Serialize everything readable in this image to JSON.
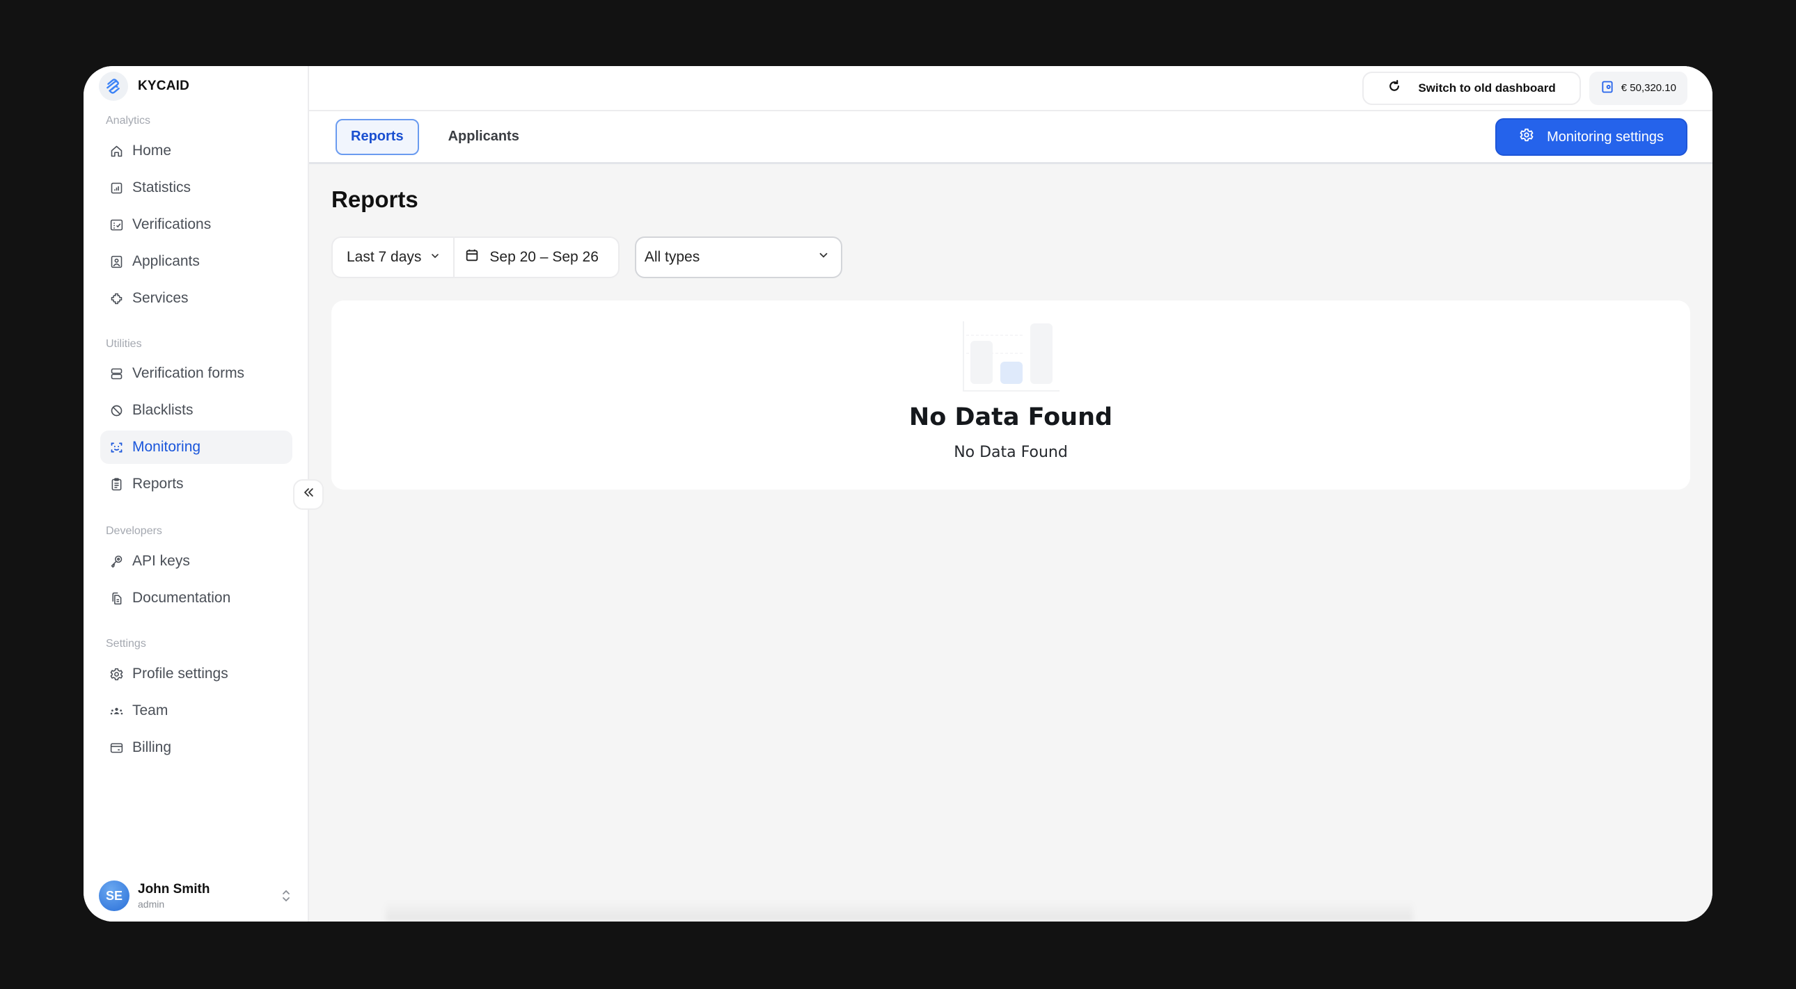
{
  "brand": {
    "name": "KYCAID",
    "icon": "kycaid-logo-icon"
  },
  "sidebar": {
    "sections": [
      {
        "label": "Analytics",
        "items": [
          {
            "label": "Home",
            "icon": "home-icon"
          },
          {
            "label": "Statistics",
            "icon": "statistics-icon"
          },
          {
            "label": "Verifications",
            "icon": "verifications-icon"
          },
          {
            "label": "Applicants",
            "icon": "applicants-icon"
          },
          {
            "label": "Services",
            "icon": "services-icon"
          }
        ]
      },
      {
        "label": "Utilities",
        "items": [
          {
            "label": "Verification forms",
            "icon": "forms-icon"
          },
          {
            "label": "Blacklists",
            "icon": "blacklist-icon"
          },
          {
            "label": "Monitoring",
            "icon": "face-scan-icon",
            "active": true
          },
          {
            "label": "Reports",
            "icon": "clipboard-icon"
          }
        ]
      },
      {
        "label": "Developers",
        "items": [
          {
            "label": "API keys",
            "icon": "key-icon"
          },
          {
            "label": "Documentation",
            "icon": "documents-icon"
          }
        ]
      },
      {
        "label": "Settings",
        "items": [
          {
            "label": "Profile settings",
            "icon": "gear-icon"
          },
          {
            "label": "Team",
            "icon": "team-icon"
          },
          {
            "label": "Billing",
            "icon": "card-icon"
          }
        ]
      }
    ],
    "collapse_icon": "double-chevron-left-icon",
    "user": {
      "initials": "SE",
      "name": "John Smith",
      "role": "admin"
    }
  },
  "topbar": {
    "switch_label": "Switch to old dashboard",
    "balance": "€ 50,320.10"
  },
  "tabs": [
    {
      "label": "Reports",
      "active": true
    },
    {
      "label": "Applicants",
      "active": false
    }
  ],
  "monitoring_settings_label": "Monitoring settings",
  "page": {
    "title": "Reports",
    "filters": {
      "range_preset": "Last 7 days",
      "date_range": "Sep 20 – Sep 26",
      "type": "All types"
    },
    "empty": {
      "title": "No Data Found",
      "subtitle": "No Data Found"
    }
  },
  "colors": {
    "accent": "#2563eb",
    "active_text": "#1a56db",
    "background": "#f5f5f5"
  }
}
